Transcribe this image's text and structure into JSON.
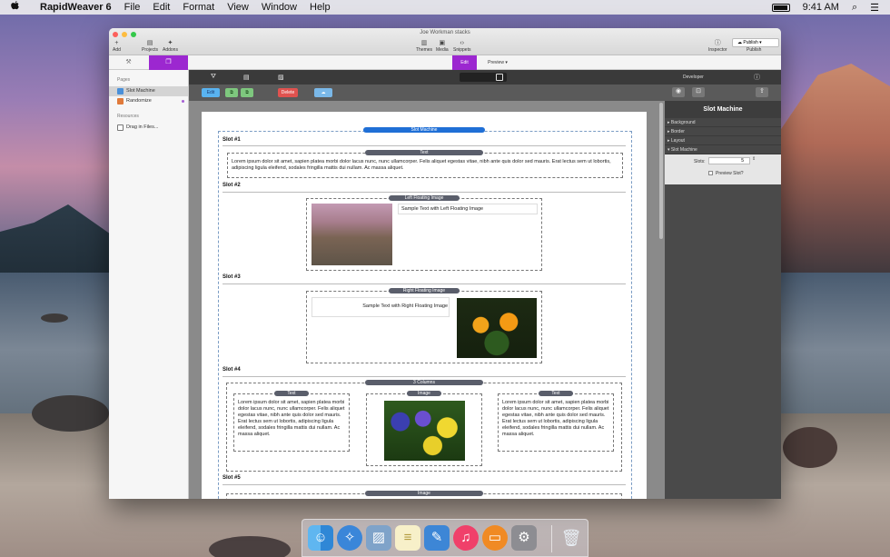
{
  "menubar": {
    "apple": "",
    "app": "RapidWeaver 6",
    "items": [
      "File",
      "Edit",
      "Format",
      "View",
      "Window",
      "Help"
    ],
    "time": "9:41 AM"
  },
  "window": {
    "title": "Joe Workman stacks",
    "toolbar": {
      "add": "Add",
      "projects": "Projects",
      "addons": "Addons",
      "themes": "Themes",
      "media": "Media",
      "snippets": "Snippets",
      "inspector": "Inspector",
      "publish_button": "Publish",
      "publish": "Publish"
    },
    "modes": {
      "edit": "Edit",
      "preview": "Preview"
    }
  },
  "sidebar": {
    "pages_header": "Pages",
    "pages": [
      {
        "label": "Slot Machine",
        "color": "#4a90d9"
      },
      {
        "label": "Randomize",
        "color": "#e07a3a"
      }
    ],
    "resources_header": "Resources",
    "resources": [
      {
        "label": "Drag in Files..."
      }
    ]
  },
  "stack_toolbar": {
    "edit": "Edit",
    "delete": "Delete"
  },
  "canvas": {
    "root_label": "Slot Machine",
    "slots": [
      {
        "title": "Slot #1",
        "stack_label": "Text",
        "text": "Lorem ipsum dolor sit amet, sapien platea morbi dolor lacus nunc, nunc ullamcorper. Felis aliquet egestas vitae, nibh ante quis dolor sed mauris. Erat lectus sem ut lobortis, adipiscing ligula eleifend, sodales fringilla mattis dui nullam. Ac massa aliquet."
      },
      {
        "title": "Slot #2",
        "stack_label": "Left Floating Image",
        "text": "Sample Text with Left Floating Image"
      },
      {
        "title": "Slot #3",
        "stack_label": "Right Floating Image",
        "text": "Sample Text with Right Floating Image"
      },
      {
        "title": "Slot #4",
        "stack_label": "3 Columns",
        "columns": [
          {
            "label": "Text",
            "text": "Lorem ipsum dolor sit amet, sapien platea morbi dolor lacus nunc, nunc ullamcorper. Felis aliquet egestas vitae, nibh ante quis dolor sed mauris. Erat lectus sem ut lobortis, adipiscing ligula eleifend, sodales fringilla mattis dui nullam. Ac massa aliquet."
          },
          {
            "label": "Image"
          },
          {
            "label": "Text",
            "text": "Lorem ipsum dolor sit amet, sapien platea morbi dolor lacus nunc, nunc ullamcorper. Felis aliquet egestas vitae, nibh ante quis dolor sed mauris. Erat lectus sem ut lobortis, adipiscing ligula eleifend, sodales fringilla mattis dui nullam. Ac massa aliquet."
          }
        ]
      },
      {
        "title": "Slot #5",
        "stack_label": "Image"
      }
    ]
  },
  "inspector": {
    "header": "Developer",
    "title": "Slot Machine",
    "sections": [
      "Background",
      "Border",
      "Layout",
      "Slot Machine"
    ],
    "slots_label": "Slots:",
    "slots_value": "5",
    "preview_label": "Preview Slot?"
  }
}
